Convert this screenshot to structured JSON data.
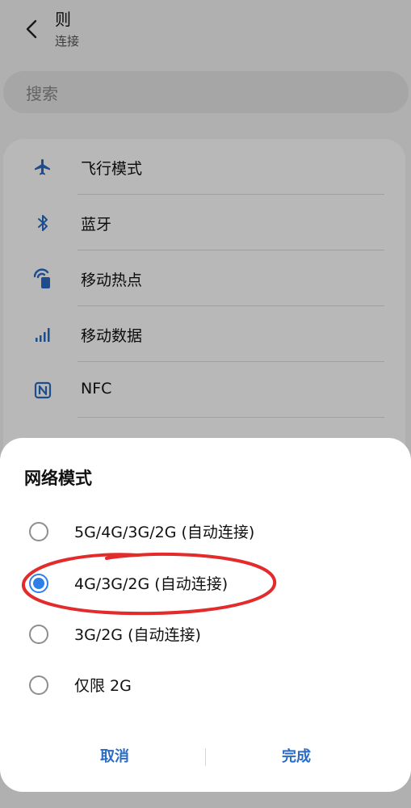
{
  "header": {
    "title": "则",
    "subtitle": "连接"
  },
  "search": {
    "placeholder": "搜索"
  },
  "settings": {
    "items": [
      {
        "label": "飞行模式",
        "icon": "airplane-icon"
      },
      {
        "label": "蓝牙",
        "icon": "bluetooth-icon"
      },
      {
        "label": "移动热点",
        "icon": "hotspot-icon"
      },
      {
        "label": "移动数据",
        "icon": "signal-bars-icon"
      },
      {
        "label": "NFC",
        "icon": "nfc-icon"
      }
    ]
  },
  "dialog": {
    "title": "网络模式",
    "options": [
      {
        "label": "5G/4G/3G/2G (自动连接)",
        "selected": false
      },
      {
        "label": "4G/3G/2G (自动连接)",
        "selected": true
      },
      {
        "label": "3G/2G (自动连接)",
        "selected": false
      },
      {
        "label": "仅限 2G",
        "selected": false
      }
    ],
    "cancel_label": "取消",
    "done_label": "完成"
  },
  "colors": {
    "accent": "#2f7fe6",
    "button_text": "#2a6bc4",
    "annotation_red": "#e32b2b"
  }
}
